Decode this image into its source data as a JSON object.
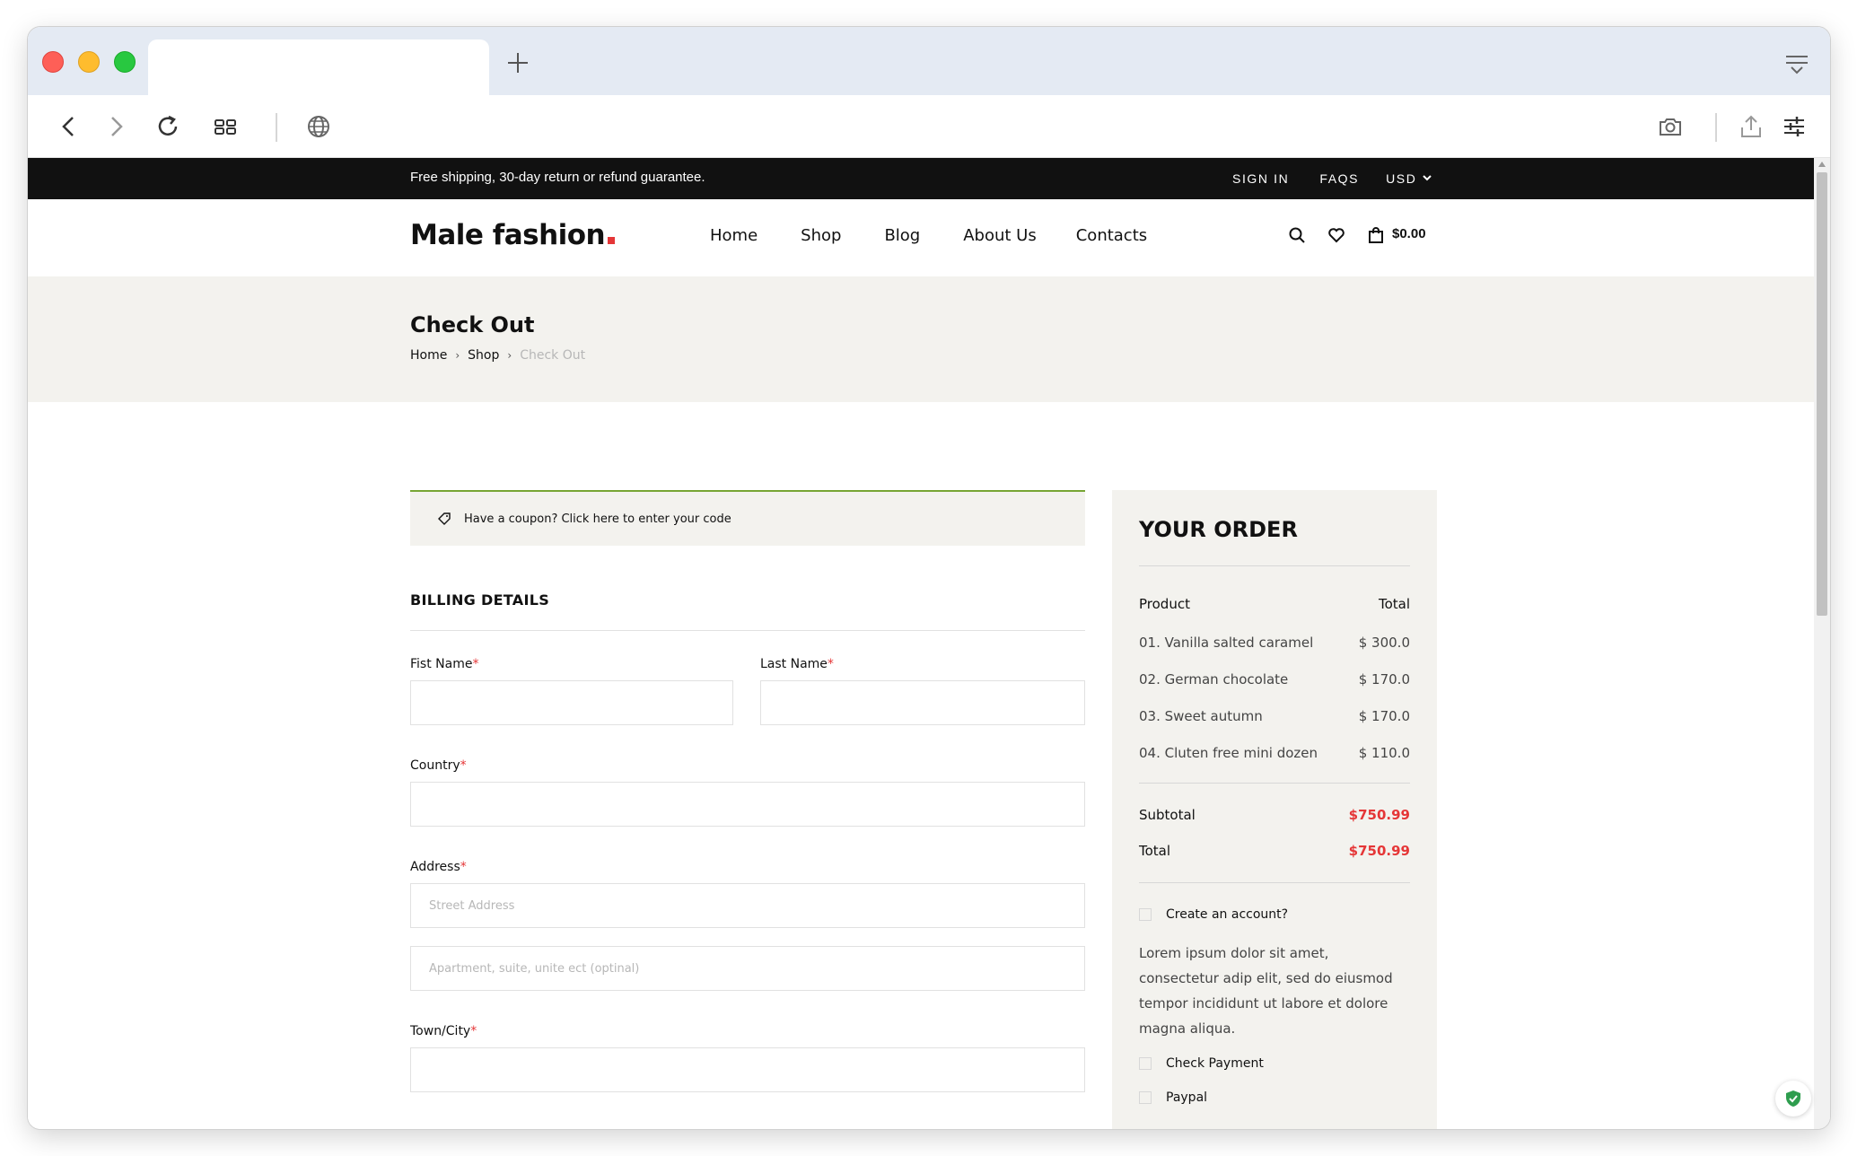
{
  "browser": {
    "tab_title": "",
    "icons": [
      "back-icon",
      "forward-icon",
      "reload-icon",
      "tab-grid-icon",
      "globe-icon",
      "camera-icon",
      "share-icon",
      "settings-sliders-icon",
      "tab-menu-icon",
      "new-tab-icon"
    ]
  },
  "topbar": {
    "promo": "Free shipping, 30-day return or refund guarantee.",
    "sign_in": "SIGN IN",
    "faqs": "FAQS",
    "currency": "USD"
  },
  "header": {
    "logo": "Male fashion",
    "nav": [
      "Home",
      "Shop",
      "Blog",
      "About Us",
      "Contacts"
    ],
    "cart_total": "$0.00"
  },
  "breadcrumb": {
    "title": "Check Out",
    "items": [
      "Home",
      "Shop",
      "Check Out"
    ]
  },
  "coupon": {
    "text": "Have a coupon? Click here to enter your code"
  },
  "billing": {
    "title": "BILLING DETAILS",
    "first_name_label": "Fist Name",
    "last_name_label": "Last Name",
    "country_label": "Country",
    "address_label": "Address",
    "street_placeholder": "Street Address",
    "apartment_placeholder": "Apartment, suite, unite ect (optinal)",
    "town_label": "Town/City",
    "required_mark": "*"
  },
  "order": {
    "title": "YOUR ORDER",
    "col_product": "Product",
    "col_total": "Total",
    "items": [
      {
        "name": "01. Vanilla salted caramel",
        "price": "$ 300.0"
      },
      {
        "name": "02. German chocolate",
        "price": "$ 170.0"
      },
      {
        "name": "03. Sweet autumn",
        "price": "$ 170.0"
      },
      {
        "name": "04. Cluten free mini dozen",
        "price": "$ 110.0"
      }
    ],
    "subtotal_label": "Subtotal",
    "subtotal_value": "$750.99",
    "total_label": "Total",
    "total_value": "$750.99",
    "create_account": "Create an account?",
    "description": "Lorem ipsum dolor sit amet, consectetur adip elit, sed do eiusmod tempor incididunt ut labore et dolore magna aliqua.",
    "check_payment": "Check Payment",
    "paypal": "Paypal"
  },
  "colors": {
    "accent_red": "#e53637",
    "coupon_border": "#77a534",
    "panel_bg": "#f3f2ee"
  }
}
